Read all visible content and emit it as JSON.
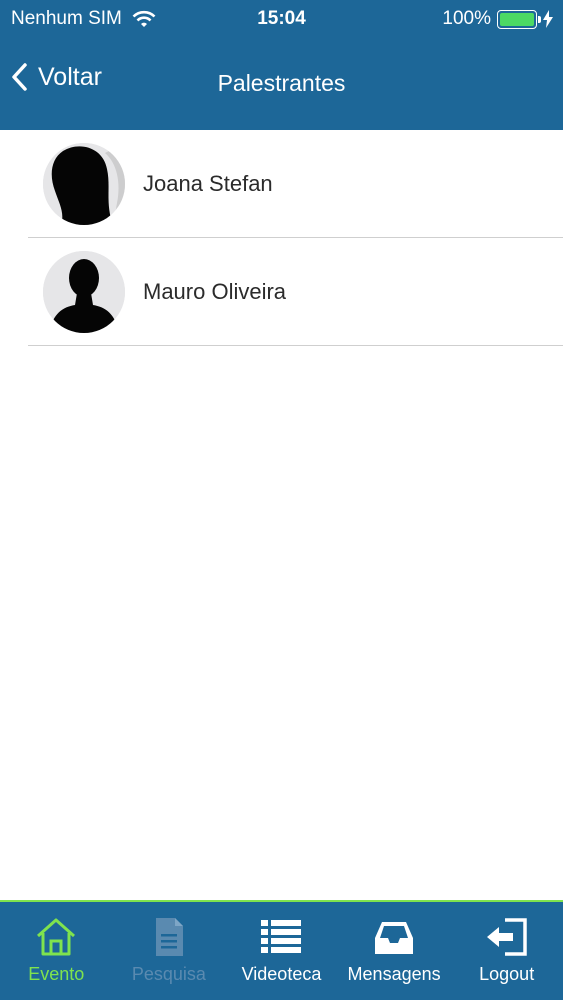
{
  "status_bar": {
    "carrier": "Nenhum SIM",
    "time": "15:04",
    "battery": "100%",
    "battery_color": "#4cd964"
  },
  "nav": {
    "back_label": "Voltar",
    "title": "Palestrantes"
  },
  "speakers": [
    {
      "name": "Joana Stefan",
      "avatar_icon": "person-silhouette-female"
    },
    {
      "name": "Mauro Oliveira",
      "avatar_icon": "person-silhouette-male"
    }
  ],
  "tabs": [
    {
      "label": "Evento",
      "icon": "home-icon",
      "state": "active"
    },
    {
      "label": "Pesquisa",
      "icon": "document-icon",
      "state": "disabled"
    },
    {
      "label": "Videoteca",
      "icon": "list-icon",
      "state": "normal"
    },
    {
      "label": "Mensagens",
      "icon": "inbox-icon",
      "state": "normal"
    },
    {
      "label": "Logout",
      "icon": "logout-icon",
      "state": "normal"
    }
  ],
  "colors": {
    "header_bg": "#1d6798",
    "accent": "#7fe34e",
    "disabled": "#5a8ab0"
  }
}
